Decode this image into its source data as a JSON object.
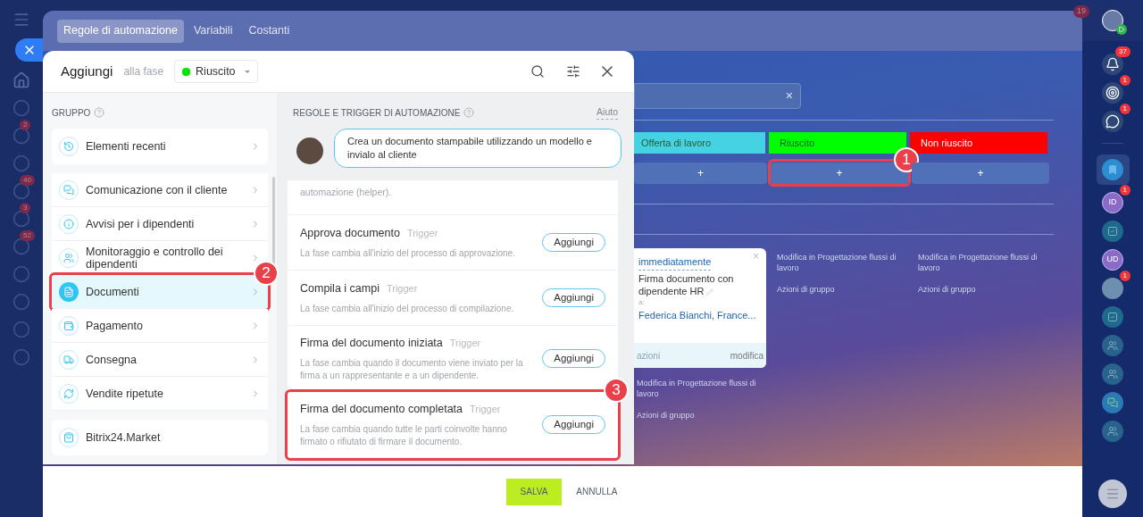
{
  "left_nav": {
    "items": [
      {
        "kind": "close"
      },
      {
        "kind": "home"
      },
      {
        "kind": "icon"
      },
      {
        "kind": "icon",
        "badge": "2"
      },
      {
        "kind": "icon"
      },
      {
        "kind": "icon",
        "badge": "40"
      },
      {
        "kind": "icon",
        "badge": "3"
      },
      {
        "kind": "icon",
        "badge": "52"
      },
      {
        "kind": "icon"
      },
      {
        "kind": "icon"
      },
      {
        "kind": "icon"
      },
      {
        "kind": "icon"
      }
    ]
  },
  "top_badge": "19",
  "tabs": [
    {
      "label": "Regole di automazione",
      "selected": true
    },
    {
      "label": "Variabili",
      "selected": false
    },
    {
      "label": "Costanti",
      "selected": false
    }
  ],
  "dialog": {
    "title": "Aggiungi",
    "subtitle": "alla fase",
    "stage": {
      "label": "Riuscito",
      "color": "#00e600"
    },
    "group": {
      "heading": "GRUPPO",
      "recent": "Elementi recenti",
      "items": [
        {
          "label": "Comunicazione con il cliente",
          "selected": false
        },
        {
          "label": "Avvisi per i dipendenti",
          "selected": false
        },
        {
          "label": "Monitoraggio e controllo dei dipendenti",
          "selected": false
        },
        {
          "label": "Documenti",
          "selected": true,
          "callout": "2"
        },
        {
          "label": "Pagamento",
          "selected": false
        },
        {
          "label": "Consegna",
          "selected": false
        },
        {
          "label": "Vendite ripetute",
          "selected": false
        }
      ],
      "market": "Bitrix24.Market"
    },
    "rules": {
      "heading": "REGOLE E TRIGGER DI AUTOMAZIONE",
      "help": "Aiuto",
      "bubble": "Crea un documento stampabile utilizzando un modello e invialo al cliente",
      "previous_tail": "automazione (helper).",
      "items": [
        {
          "title": "Approva documento",
          "tag": "Trigger",
          "description": "La fase cambia all'inizio del processo di approvazione.",
          "button": "Aggiungi"
        },
        {
          "title": "Compila i campi",
          "tag": "Trigger",
          "description": "La fase cambia all'inizio del processo di compilazione.",
          "button": "Aggiungi"
        },
        {
          "title": "Firma del documento iniziata",
          "tag": "Trigger",
          "description": "La fase cambia quando il documento viene inviato per la firma a un rappresentante e a un dipendente.",
          "button": "Aggiungi"
        },
        {
          "title": "Firma del documento completata",
          "tag": "Trigger",
          "description": "La fase cambia quando tutte le parti coinvolte hanno firmato o rifiutato di firmare il documento.",
          "button": "Aggiungi",
          "callout": "3"
        }
      ]
    }
  },
  "board": {
    "search_clear": "×",
    "stages": [
      {
        "label": "Offerta di lavoro",
        "color": "#45d3e3"
      },
      {
        "label": "Riuscito",
        "color": "#00ff00"
      },
      {
        "label": "Non riuscito",
        "color": "#ff0000"
      }
    ],
    "add_buttons": [
      {
        "label": "+"
      },
      {
        "label": "+",
        "callout": "1"
      },
      {
        "label": "+"
      }
    ],
    "card": {
      "close": "×",
      "delay": "immediatamente",
      "title": "Firma documento con dipendente HR",
      "to": "a:",
      "recipients": "Federica Bianchi, France...",
      "footer_left": "azioni",
      "footer_right": "modifica"
    },
    "column_links": [
      {
        "edit": "Modifica in Progettazione flussi di lavoro",
        "group": "Azioni di gruppo"
      },
      {
        "edit": "Modifica in Progettazione flussi di lavoro",
        "group": "Azioni di gruppo"
      }
    ],
    "lower_links": {
      "edit": "Modifica in Progettazione flussi di lavoro",
      "group": "Azioni di gruppo"
    }
  },
  "footer": {
    "save": "SALVA",
    "cancel": "ANNULLA"
  },
  "right_bar": {
    "items": [
      {
        "kind": "bell",
        "badge": "37"
      },
      {
        "kind": "target",
        "badge": "1"
      },
      {
        "kind": "chat",
        "badge": "1"
      },
      {
        "kind": "divider"
      },
      {
        "kind": "bookmark",
        "selected": true
      },
      {
        "kind": "initials",
        "text": "ID",
        "badge": "1"
      },
      {
        "kind": "task"
      },
      {
        "kind": "initials",
        "text": "UD"
      },
      {
        "kind": "avatar",
        "badge": "1"
      },
      {
        "kind": "task"
      },
      {
        "kind": "people"
      },
      {
        "kind": "people"
      },
      {
        "kind": "chat2"
      },
      {
        "kind": "people"
      }
    ]
  }
}
